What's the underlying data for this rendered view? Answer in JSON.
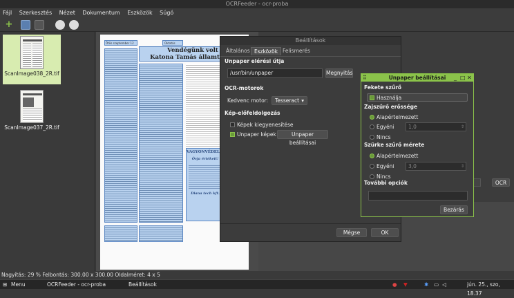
{
  "window": {
    "title": "OCRFeeder - ocr-proba"
  },
  "menu": [
    "Fájl",
    "Szerkesztés",
    "Nézet",
    "Dokumentum",
    "Eszközök",
    "Súgó"
  ],
  "thumbnails": [
    {
      "label": "ScanImage038_2R.tif"
    },
    {
      "label": "ScanImage037_2R.tif"
    }
  ],
  "document": {
    "header_left": "Ötös szeptember 12",
    "header_mid": "Oktatás",
    "headline1": "Vendégünk volt",
    "headline2": "Katona Tamás államtitkár",
    "box_title": "VAGYONVÉDELEM",
    "box_line1": "Óvja értékeit!",
    "box_line2": "Diana tech kft."
  },
  "right_pane": {
    "ocr_label": "OCR"
  },
  "status": "Nagyítás: 29 % Felbontás: 300.00 x 300.00 Oldalméret: 4 x 5",
  "taskbar": {
    "menu": "Menu",
    "task1": "OCRFeeder - ocr-proba",
    "task2": "Beállítások",
    "clock": "jún. 25., szo, 18.37"
  },
  "prefs_dialog": {
    "title": "Beállítások",
    "tabs": [
      "Általános",
      "Eszközök",
      "Felismerés"
    ],
    "unpaper_path_label": "Unpaper elérési útja",
    "unpaper_path_value": "/usr/bin/unpaper",
    "browse_button": "Megnyitás",
    "ocr_engines_label": "OCR-motorok",
    "favorite_engine_label": "Kedvenc motor:",
    "favorite_engine_value": "Tesseract",
    "preprocessing_label": "Kép-előfeldolgozás",
    "deskew_label": "Képek kiegyenesítése",
    "unpaper_images_label": "Unpaper képek",
    "unpaper_settings_button": "Unpaper beállításai",
    "cancel_button": "Mégse",
    "ok_button": "OK"
  },
  "unpaper_dialog": {
    "title": "Unpaper beállításai",
    "black_filter_label": "Fekete szűrő",
    "use_label": "Használja",
    "noise_filter_label": "Zajszűrő erőssége",
    "default_label": "Alapértelmezett",
    "custom_label": "Egyéni",
    "custom_value": "1,0",
    "none_label": "Nincs",
    "gray_filter_label": "Szürke szűrő mérete",
    "default_label2": "Alapértelmezett",
    "custom_label2": "Egyéni",
    "custom_value2": "3,0",
    "none_label2": "Nincs",
    "extra_options_label": "További opciók",
    "close_button": "Bezárás"
  },
  "colors": {
    "accent": "#8bc34a",
    "selection": "#d8ecb0"
  }
}
